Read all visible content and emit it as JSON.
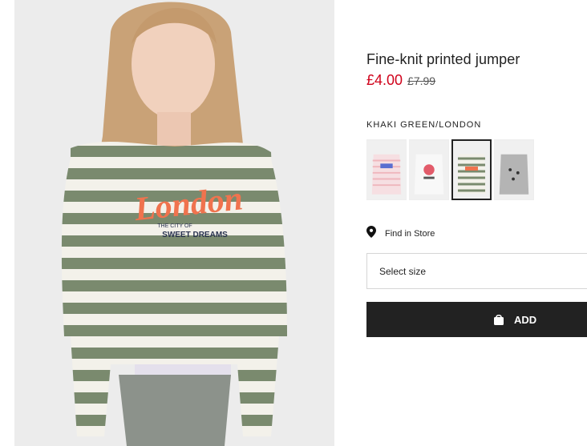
{
  "product": {
    "title": "Fine-knit printed jumper",
    "price_current": "£4.00",
    "price_original": "£7.99",
    "color_name": "KHAKI GREEN/LONDON",
    "image_print": {
      "line1": "London",
      "line2": "THE CITY OF",
      "line3": "SWEET DREAMS"
    }
  },
  "swatches": [
    {
      "name": "pink-stripe",
      "accent": "#f4c4c8",
      "selected": false
    },
    {
      "name": "white-print",
      "accent": "#e8e8e8",
      "selected": false
    },
    {
      "name": "khaki-green-london",
      "accent": "#7a8a70",
      "selected": true
    },
    {
      "name": "grey-print",
      "accent": "#9a9a9a",
      "selected": false
    }
  ],
  "store": {
    "find_label": "Find in Store",
    "icon": "map-pin-icon"
  },
  "size": {
    "placeholder": "Select size"
  },
  "cart": {
    "add_label": "ADD",
    "icon": "shopping-bag-icon"
  },
  "colors": {
    "sale": "#d0021b",
    "button": "#222222",
    "stripe_green": "#7a8a6e",
    "print_orange": "#f0734e",
    "print_navy": "#2a3350"
  }
}
